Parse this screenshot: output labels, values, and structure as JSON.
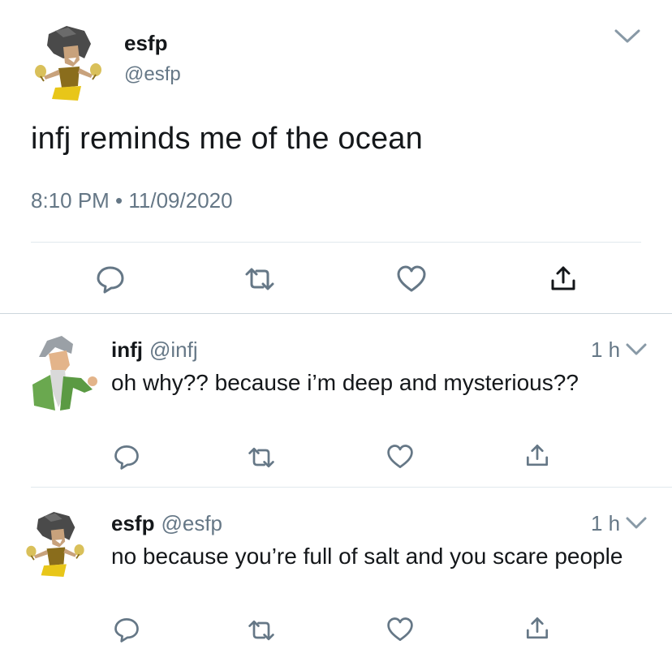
{
  "main_tweet": {
    "name": "esfp",
    "handle": "@esfp",
    "text": "infj reminds me of the ocean",
    "timestamp": "8:10 PM • 11/09/2020"
  },
  "replies": [
    {
      "name": "infj",
      "handle": "@infj",
      "time": "1 h",
      "text": "oh why?? because i’m deep and mysterious??",
      "avatar": "sage-avatar"
    },
    {
      "name": "esfp",
      "handle": "@esfp",
      "time": "1 h",
      "text": "no because you’re full of salt and you scare people",
      "avatar": "maracas-dancer-avatar"
    }
  ],
  "icons": [
    "reply-icon",
    "retweet-icon",
    "like-icon",
    "share-icon",
    "chevron-down-icon"
  ],
  "colors": {
    "text": "#14171a",
    "secondary": "#657786",
    "icon": "#657786",
    "divider": "#e1e8ed"
  }
}
